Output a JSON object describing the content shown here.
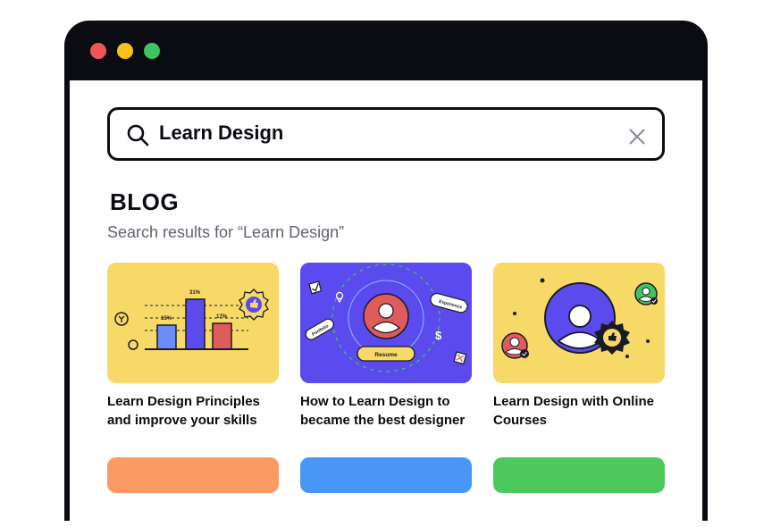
{
  "search": {
    "query": "Learn Design"
  },
  "blog": {
    "heading": "BLOG",
    "subtitle": "Search results for “Learn Design”"
  },
  "cards": [
    {
      "title": "Learn Design Principles and improve your skills",
      "bg": "#f7d968",
      "chart_labels": [
        "15%",
        "31%",
        "17%"
      ]
    },
    {
      "title": "How to Learn Design to became the best designer",
      "bg": "#5b4bef",
      "tags": [
        "Portfolio",
        "Experience",
        "Resume"
      ]
    },
    {
      "title": "Learn Design with Online Courses",
      "bg": "#f7d968"
    }
  ],
  "next_row_colors": [
    "#fa9a64",
    "#4896f5",
    "#4cc95a"
  ],
  "colors": {
    "window": "#0b0b12",
    "close": "#f0555a",
    "minimize": "#f7c21a",
    "maximize": "#3ec55f",
    "blue": "#5b4bef",
    "red": "#e05c5c"
  }
}
